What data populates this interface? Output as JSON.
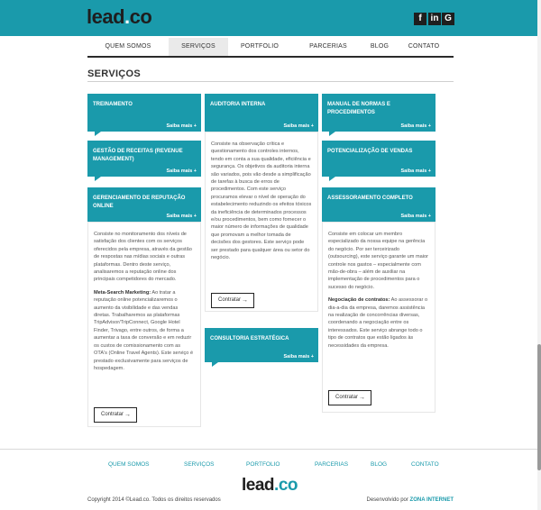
{
  "brand": {
    "logo_main": "lead",
    "logo_dot": ".",
    "logo_co": "co"
  },
  "social": {
    "facebook": "f",
    "linkedin": "in",
    "googleplus": "G"
  },
  "nav": {
    "items": [
      "QUEM SOMOS",
      "SERVIÇOS",
      "PORTFOLIO",
      "PARCERIAS",
      "BLOG",
      "CONTATO"
    ],
    "active": "SERVIÇOS"
  },
  "page": {
    "title": "SERVIÇOS"
  },
  "more_label": "Saiba mais +",
  "cta_label": "Contratar",
  "cards": {
    "treinamento": {
      "title": "TREINAMENTO"
    },
    "receitas": {
      "title": "GESTÃO DE RECEITAS (REVENUE MANAGEMENT)"
    },
    "reputacao": {
      "title": "GERENCIAMENTO DE REPUTAÇÃO ONLINE",
      "p1": "Consiste no monitoramento dos níveis de satisfação dos clientes com os serviços oferecidos pela empresa, através da gestão de respostas nas mídias sociais e outras plataformas. Dentro deste serviço, analisaremos a reputação online dos principais competidores do mercado.",
      "p2_label": "Meta-Search Marketing:",
      "p2": " Ao tratar a reputação online potencializaremos o aumento da visibilidade e das vendas diretas. Trabalharemos as plataformas TripAdvisor/TripConnect, Google Hotel Finder, Trivago, entre outros, de forma a aumentar a taxa de conversão e em reduzir os custos de comissionamento com as OTA's (Online Travel Agents). Este serviço é prestado exclusivamente para serviços de hospedagem."
    },
    "auditoria": {
      "title": "AUDITORIA INTERNA",
      "p1": "Consiste na observação crítica e questionamento dos controles internos, tendo em conta a sua qualidade, eficiência e segurança. Os objetivos da auditoria interna são variados, pois vão desde a simplificação de tarefas à busca de erros de procedimentos. Com este serviço procuramos elevar o nível de operação do estabelecimento reduzindo os efeitos tóxicos da ineficiência de determinados processos e/ou procedimentos, bem como fornecer o maior número de informações de qualidade que promovam a melhor tomada de decisões dos gestores. Este serviço pode ser prestado para qualquer área ou setor do negócio."
    },
    "consultoria": {
      "title": "CONSULTORIA ESTRATÉGICA"
    },
    "manual": {
      "title": "MANUAL DE NORMAS E PROCEDIMENTOS"
    },
    "vendas": {
      "title": "POTENCIALIZAÇÃO DE VENDAS"
    },
    "assessoramento": {
      "title": "ASSESSORAMENTO COMPLETO",
      "p1": "Consiste em colocar um membro especializado da nossa equipe na gerência do negócio. Por ser terceirizado (outsourcing), este serviço garante um maior controle nos gastos – especialmente com mão-de-obra – além de auxiliar na implementação de procedimentos para o sucesso do negócio.",
      "p2_label": "Negociação de contratos:",
      "p2": " Ao assessorar o dia-a-dia da empresa, daremos assistência na realização de concorrências diversas, coordenando a negociação entre os interessados. Este serviço abrange todo o tipo de contratos que estão ligados às necessidades da empresa."
    }
  },
  "footer": {
    "nav": [
      "QUEM SOMOS",
      "SERVIÇOS",
      "PORTFOLIO",
      "PARCERIAS",
      "BLOG",
      "CONTATO"
    ],
    "copyright": "Copyright 2014 ©Lead.co. Todos os direitos reservados",
    "dev_label": "Desenvolvido por ",
    "dev_brand": "ZONA INTERNET"
  },
  "colors": {
    "accent": "#1a9aab",
    "dark": "#1e1e1e"
  }
}
